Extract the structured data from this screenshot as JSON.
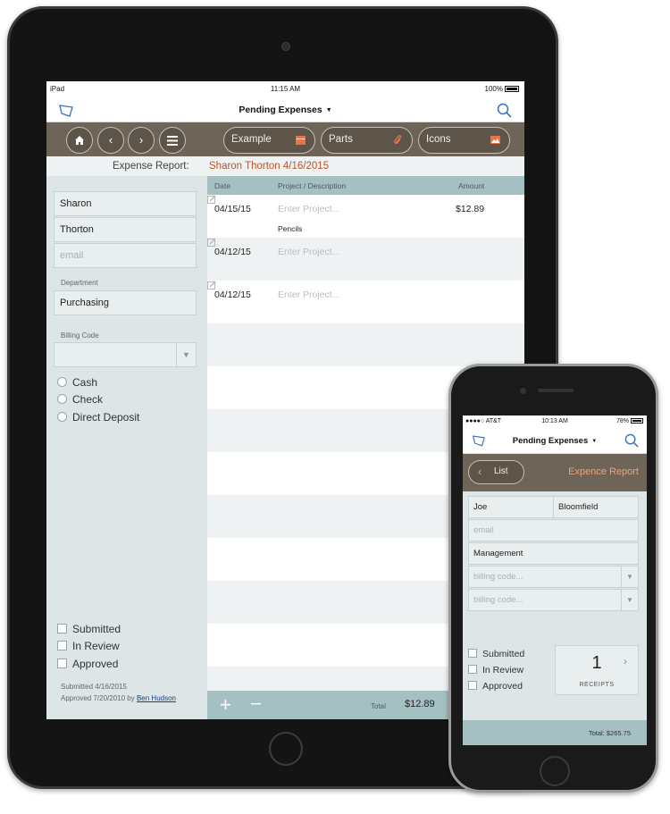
{
  "ipad": {
    "status": {
      "carrier": "iPad",
      "time": "11:15 AM",
      "battery": "100%"
    },
    "nav": {
      "title": "Pending Expenses",
      "logo_icon": "folder-logo-icon",
      "search_icon": "search-icon"
    },
    "toolbar": {
      "buttons": [
        "home-icon",
        "chevron-left-icon",
        "chevron-right-icon",
        "menu-icon"
      ],
      "pills": [
        {
          "label": "Example",
          "icon": "calendar-icon"
        },
        {
          "label": "Parts",
          "icon": "paperclip-icon"
        },
        {
          "label": "Icons",
          "icon": "image-icon"
        }
      ]
    },
    "report": {
      "label": "Expense Report:",
      "value": "Sharon Thorton 4/16/2015"
    },
    "form": {
      "first_name": "Sharon",
      "last_name": "Thorton",
      "email_placeholder": "email",
      "department_label": "Department",
      "department": "Purchasing",
      "billing_code_label": "Billing Code",
      "payment_options": [
        "Cash",
        "Check",
        "Direct Deposit"
      ],
      "status_options": [
        "Submitted",
        "In Review",
        "Approved"
      ],
      "submitted_line": "Submitted 4/16/2015",
      "approved_prefix": "Approved 7/20/2010 by",
      "approved_by": "Ben Hudson"
    },
    "table": {
      "headers": {
        "date": "Date",
        "project": "Project / Description",
        "amount": "Amount"
      },
      "rows": [
        {
          "date": "04/15/15",
          "project_placeholder": "Enter Project...",
          "description": "Pencils",
          "amount": "$12.89"
        },
        {
          "date": "04/12/15",
          "project_placeholder": "Enter Project...",
          "description": "",
          "amount": ""
        },
        {
          "date": "04/12/15",
          "project_placeholder": "Enter Project...",
          "description": "",
          "amount": ""
        }
      ],
      "footer": {
        "add": "+",
        "remove": "−",
        "total_label": "Total",
        "total_value": "$12.89"
      }
    }
  },
  "iphone": {
    "status": {
      "carrier": "●●●●○ AT&T",
      "time": "10:13 AM",
      "battery": "78%"
    },
    "nav": {
      "title": "Pending Expenses"
    },
    "toolbar": {
      "back_label": "List",
      "title": "Expence Report"
    },
    "form": {
      "first_name": "Joe",
      "last_name": "Bloomfield",
      "email_placeholder": "email",
      "department": "Management",
      "billing_placeholder_1": "billing code...",
      "billing_placeholder_2": "billing code...",
      "status_options": [
        "Submitted",
        "In Review",
        "Approved"
      ],
      "receipts_count": "1",
      "receipts_label": "RECEIPTS",
      "total": "Total:  $265.75"
    }
  },
  "colors": {
    "toolbar": "#6e6458",
    "accent": "#c0532a",
    "panel": "#dde5e6",
    "table_header": "#a5c0c3"
  }
}
